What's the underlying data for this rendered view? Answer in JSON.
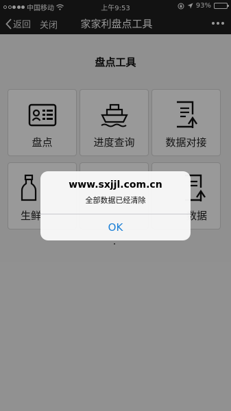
{
  "status_bar": {
    "carrier": "中国移动",
    "time": "上午9:53",
    "battery_percent": "93%",
    "battery_level": 0.93,
    "icons": [
      "signal-icon",
      "wifi-icon",
      "rotation-lock-icon",
      "location-icon",
      "battery-icon"
    ]
  },
  "nav": {
    "back_label": "返回",
    "close_label": "关闭",
    "title": "家家利盘点工具",
    "more_icon": "more-dots-icon"
  },
  "page": {
    "title": "盘点工具",
    "tiles": [
      {
        "label": "盘点",
        "icon": "inventory-card-icon"
      },
      {
        "label": "进度查询",
        "icon": "ship-icon"
      },
      {
        "label": "数据对接",
        "icon": "document-upload-icon"
      },
      {
        "label": "生鲜",
        "icon": "bottle-icon"
      },
      {
        "label": "",
        "icon": ""
      },
      {
        "label": "数据",
        "icon": "document-upload-icon"
      }
    ]
  },
  "dialog": {
    "title": "www.sxjjl.com.cn",
    "message": "全部数据已经清除",
    "ok_label": "OK"
  },
  "colors": {
    "bar_background": "#1e1e1e",
    "ok_blue": "#1a7fd6"
  }
}
